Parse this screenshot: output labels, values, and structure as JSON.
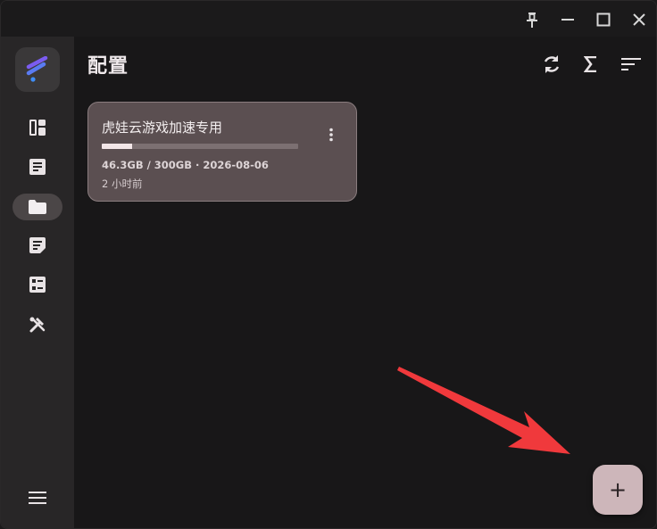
{
  "window": {
    "controls": [
      "pin-icon",
      "minimize-icon",
      "maximize-icon",
      "close-icon"
    ]
  },
  "sidebar": {
    "items": [
      {
        "name": "dashboard",
        "icon": "dashboard-icon"
      },
      {
        "name": "document",
        "icon": "document-icon"
      },
      {
        "name": "profiles",
        "icon": "folder-icon",
        "active": true
      },
      {
        "name": "notes",
        "icon": "notes-icon"
      },
      {
        "name": "list",
        "icon": "list-icon"
      },
      {
        "name": "tools",
        "icon": "tools-icon"
      }
    ],
    "menu_icon": "hamburger-icon"
  },
  "header": {
    "title": "配置",
    "actions": [
      "refresh-icon",
      "sigma-icon",
      "sort-icon"
    ]
  },
  "profiles": [
    {
      "name": "虎娃云游戏加速专用",
      "usage_fraction": 0.154,
      "meta": "46.3GB / 300GB · 2026-08-06",
      "updated": "2 小时前"
    }
  ],
  "fab": {
    "label": "+"
  },
  "colors": {
    "accent": "#cdb6ba",
    "card": "#5b4f51",
    "annotation_arrow": "#f0393c"
  }
}
